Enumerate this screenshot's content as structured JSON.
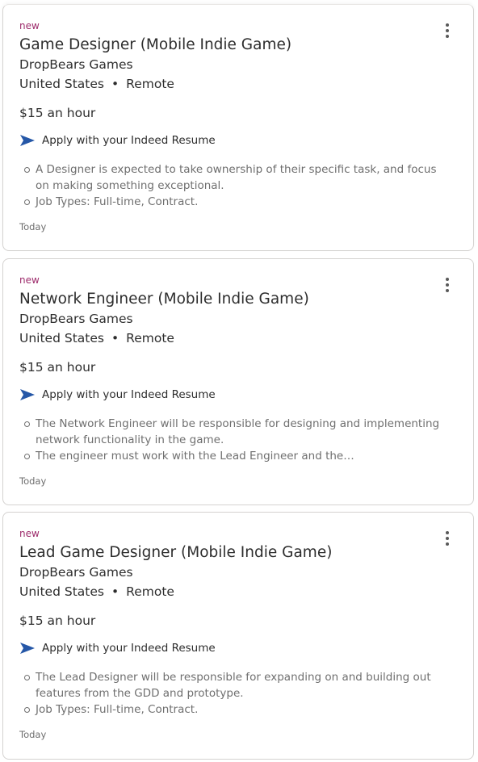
{
  "jobs": [
    {
      "badge": "new",
      "title": "Game Designer (Mobile Indie Game)",
      "company": "DropBears Games",
      "location": "United States",
      "separator": "•",
      "remote": "Remote",
      "salary": "$15 an hour",
      "apply_text": "Apply with your Indeed Resume",
      "snippet": [
        "A Designer is expected to take ownership of their specific task, and focus on making something exceptional.",
        "Job Types: Full-time, Contract."
      ],
      "date": "Today"
    },
    {
      "badge": "new",
      "title": "Network Engineer (Mobile Indie Game)",
      "company": "DropBears Games",
      "location": "United States",
      "separator": "•",
      "remote": "Remote",
      "salary": "$15 an hour",
      "apply_text": "Apply with your Indeed Resume",
      "snippet": [
        "The Network Engineer will be responsible for designing and implementing network functionality in the game.",
        "The engineer must work with the Lead Engineer and the…"
      ],
      "date": "Today"
    },
    {
      "badge": "new",
      "title": "Lead Game Designer (Mobile Indie Game)",
      "company": "DropBears Games",
      "location": "United States",
      "separator": "•",
      "remote": "Remote",
      "salary": "$15 an hour",
      "apply_text": "Apply with your Indeed Resume",
      "snippet": [
        "The Lead Designer will be responsible for expanding on and building out features from the GDD and prototype.",
        "Job Types: Full-time, Contract."
      ],
      "date": "Today"
    }
  ],
  "colors": {
    "new_badge": "#9d2b6b",
    "apply_icon": "#2557a7",
    "primary_text": "#2d2d2d",
    "secondary_text": "#6f6f6f",
    "card_border": "#d4d2d0"
  },
  "icons": {
    "apply": "send-arrow-icon",
    "menu": "more-vertical-icon"
  }
}
